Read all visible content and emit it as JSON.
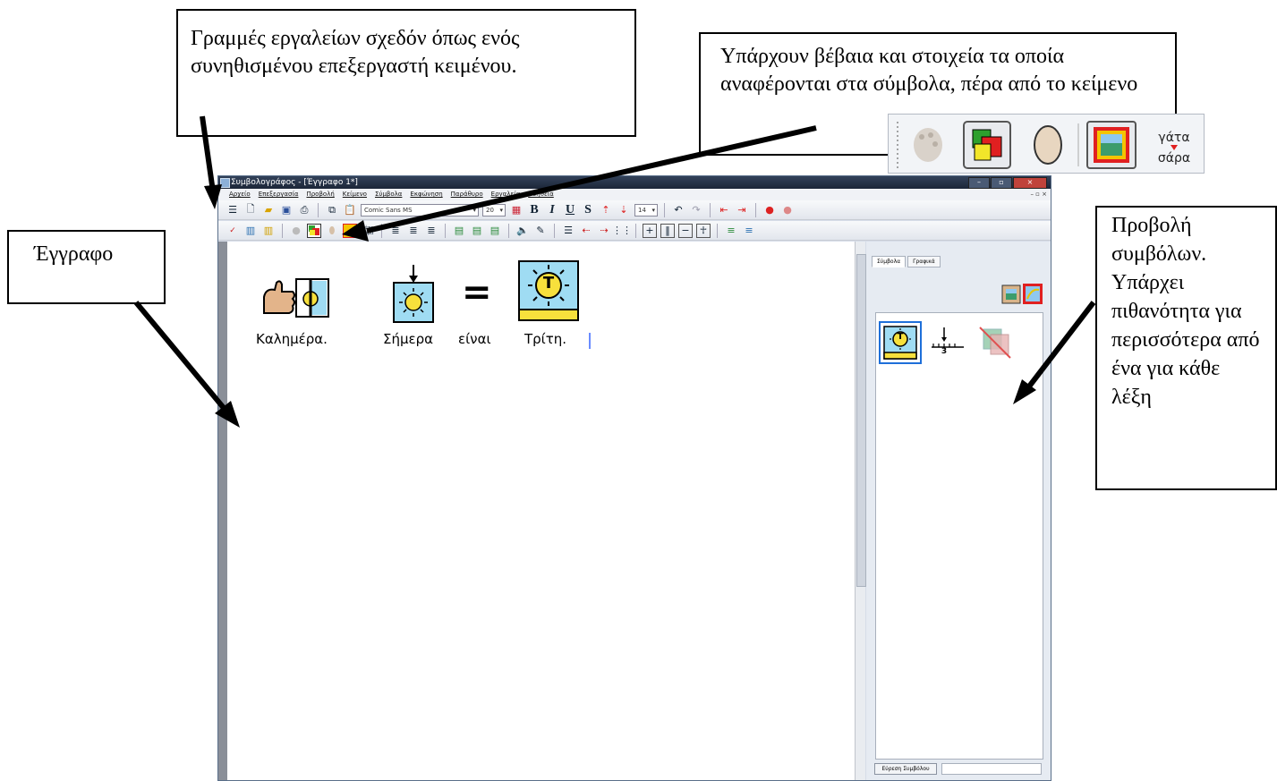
{
  "callouts": {
    "toolbars": "Γραμμές εργαλείων σχεδόν όπως ενός συνηθισμένου επεξεργαστή κειμένου.",
    "symbol_items": "Υπάρχουν βέβαια και στοιχεία τα οποία αναφέρονται στα σύμβολα, πέρα από το κείμενο",
    "document": "Έγγραφο",
    "symbol_view": "Προβολή συμβόλων. Υπάρχει πιθανότητα για περισσότερα από ένα για κάθε λέξη"
  },
  "zoom_toolbar": {
    "word_top": "γάτα",
    "word_bottom": "σάρα"
  },
  "window": {
    "title": "Συμβολογράφος - [Έγγραφο 1*]",
    "menu": [
      "Αρχείο",
      "Επεξεργασία",
      "Προβολή",
      "Κείμενο",
      "Σύμβολα",
      "Εκφώνηση",
      "Παράθυρο",
      "Εργαλεία",
      "Βοήθεια"
    ],
    "font_name": "Comic Sans MS",
    "font_size": "20",
    "spacing_value": "14",
    "small_word_top": "γάτα",
    "small_word_bottom": "σάρα"
  },
  "document": {
    "words": [
      "Καλημέρα.",
      "Σήμερα",
      "είναι",
      "Τρίτη."
    ],
    "equals_symbol": "=",
    "sun_letter": "T"
  },
  "panel": {
    "tabs": [
      "Σύμβολα",
      "Γραφικά"
    ],
    "find_button": "Εύρεση Συμβόλου",
    "calendar_number": "3",
    "selected_sun_letter": "T"
  },
  "colors": {
    "highlight": "#1e6fd9",
    "sun_yellow": "#f7e03c",
    "sky_blue": "#9fdcf3",
    "red": "#e02020",
    "green": "#2da02d"
  }
}
